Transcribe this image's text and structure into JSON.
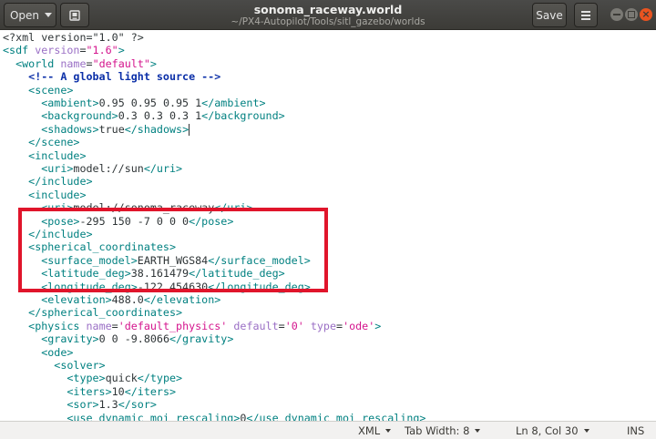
{
  "window": {
    "title": "sonoma_raceway.world",
    "path": "~/PX4-Autopilot/Tools/sitl_gazebo/worlds"
  },
  "toolbar": {
    "open_label": "Open",
    "open_icon": "chevron-down-icon",
    "new_doc_icon": "new-document-icon",
    "save_label": "Save",
    "menu_icon": "hamburger-menu-icon"
  },
  "editor": {
    "lines": [
      [
        [
          "x",
          "<?xml version=\"1.0\" ?>"
        ]
      ],
      [
        [
          "t",
          "<sdf"
        ],
        [
          "x",
          " "
        ],
        [
          "a",
          "version"
        ],
        [
          "x",
          "="
        ],
        [
          "v",
          "\"1.6\""
        ],
        [
          "t",
          ">"
        ]
      ],
      [
        [
          "x",
          "  "
        ],
        [
          "t",
          "<world"
        ],
        [
          "x",
          " "
        ],
        [
          "a",
          "name"
        ],
        [
          "x",
          "="
        ],
        [
          "v",
          "\"default\""
        ],
        [
          "t",
          ">"
        ]
      ],
      [
        [
          "x",
          "    "
        ],
        [
          "c",
          "<!-- A global light source -->"
        ]
      ],
      [
        [
          "x",
          "    "
        ],
        [
          "t",
          "<scene>"
        ]
      ],
      [
        [
          "x",
          "      "
        ],
        [
          "t",
          "<ambient>"
        ],
        [
          "x",
          "0.95 0.95 0.95 1"
        ],
        [
          "t",
          "</ambient>"
        ]
      ],
      [
        [
          "x",
          "      "
        ],
        [
          "t",
          "<background>"
        ],
        [
          "x",
          "0.3 0.3 0.3 1"
        ],
        [
          "t",
          "</background>"
        ]
      ],
      [
        [
          "x",
          "      "
        ],
        [
          "t",
          "<shadows>"
        ],
        [
          "x",
          "true"
        ],
        [
          "t",
          "</shadows>"
        ]
      ],
      [
        [
          "x",
          "    "
        ],
        [
          "t",
          "</scene>"
        ]
      ],
      [
        [
          "x",
          "    "
        ],
        [
          "t",
          "<include>"
        ]
      ],
      [
        [
          "x",
          "      "
        ],
        [
          "t",
          "<uri>"
        ],
        [
          "x",
          "model://sun"
        ],
        [
          "t",
          "</uri>"
        ]
      ],
      [
        [
          "x",
          "    "
        ],
        [
          "t",
          "</include>"
        ]
      ],
      [
        [
          "x",
          "    "
        ],
        [
          "t",
          "<include>"
        ]
      ],
      [
        [
          "x",
          "      "
        ],
        [
          "t",
          "<uri>"
        ],
        [
          "x",
          "model://sonoma_raceway"
        ],
        [
          "t",
          "</uri>"
        ]
      ],
      [
        [
          "x",
          "      "
        ],
        [
          "t",
          "<pose>"
        ],
        [
          "x",
          "-295 150 -7 0 0 0"
        ],
        [
          "t",
          "</pose>"
        ]
      ],
      [
        [
          "x",
          "    "
        ],
        [
          "t",
          "</include>"
        ]
      ],
      [
        [
          "x",
          "    "
        ],
        [
          "t",
          "<spherical_coordinates>"
        ]
      ],
      [
        [
          "x",
          "      "
        ],
        [
          "t",
          "<surface_model>"
        ],
        [
          "x",
          "EARTH_WGS84"
        ],
        [
          "t",
          "</surface_model>"
        ]
      ],
      [
        [
          "x",
          "      "
        ],
        [
          "t",
          "<latitude_deg>"
        ],
        [
          "x",
          "38.161479"
        ],
        [
          "t",
          "</latitude_deg>"
        ]
      ],
      [
        [
          "x",
          "      "
        ],
        [
          "t",
          "<longitude_deg>"
        ],
        [
          "x",
          "-122.454630"
        ],
        [
          "t",
          "</longitude_deg>"
        ]
      ],
      [
        [
          "x",
          "      "
        ],
        [
          "t",
          "<elevation>"
        ],
        [
          "x",
          "488.0"
        ],
        [
          "t",
          "</elevation>"
        ]
      ],
      [
        [
          "x",
          "    "
        ],
        [
          "t",
          "</spherical_coordinates>"
        ]
      ],
      [
        [
          "x",
          "    "
        ],
        [
          "t",
          "<physics"
        ],
        [
          "x",
          " "
        ],
        [
          "a",
          "name"
        ],
        [
          "x",
          "="
        ],
        [
          "v",
          "'default_physics'"
        ],
        [
          "x",
          " "
        ],
        [
          "a",
          "default"
        ],
        [
          "x",
          "="
        ],
        [
          "v",
          "'0'"
        ],
        [
          "x",
          " "
        ],
        [
          "a",
          "type"
        ],
        [
          "x",
          "="
        ],
        [
          "v",
          "'ode'"
        ],
        [
          "t",
          ">"
        ]
      ],
      [
        [
          "x",
          "      "
        ],
        [
          "t",
          "<gravity>"
        ],
        [
          "x",
          "0 0 -9.8066"
        ],
        [
          "t",
          "</gravity>"
        ]
      ],
      [
        [
          "x",
          "      "
        ],
        [
          "t",
          "<ode>"
        ]
      ],
      [
        [
          "x",
          "        "
        ],
        [
          "t",
          "<solver>"
        ]
      ],
      [
        [
          "x",
          "          "
        ],
        [
          "t",
          "<type>"
        ],
        [
          "x",
          "quick"
        ],
        [
          "t",
          "</type>"
        ]
      ],
      [
        [
          "x",
          "          "
        ],
        [
          "t",
          "<iters>"
        ],
        [
          "x",
          "10"
        ],
        [
          "t",
          "</iters>"
        ]
      ],
      [
        [
          "x",
          "          "
        ],
        [
          "t",
          "<sor>"
        ],
        [
          "x",
          "1.3"
        ],
        [
          "t",
          "</sor>"
        ]
      ],
      [
        [
          "x",
          "          "
        ],
        [
          "t",
          "<use_dynamic_moi_rescaling>"
        ],
        [
          "x",
          "0"
        ],
        [
          "t",
          "</use_dynamic_moi_rescaling>"
        ]
      ]
    ],
    "cursor_line_index": 7,
    "highlight_color": "#e0152b"
  },
  "statusbar": {
    "language": "XML",
    "tab_width": "Tab Width: 8",
    "position": "Ln 8, Col 30",
    "mode": "INS"
  },
  "colors": {
    "tag": "#008080",
    "attribute": "#9a6fc5",
    "value": "#d4148d",
    "comment": "#0b2fa8",
    "accent": "#e95420"
  }
}
